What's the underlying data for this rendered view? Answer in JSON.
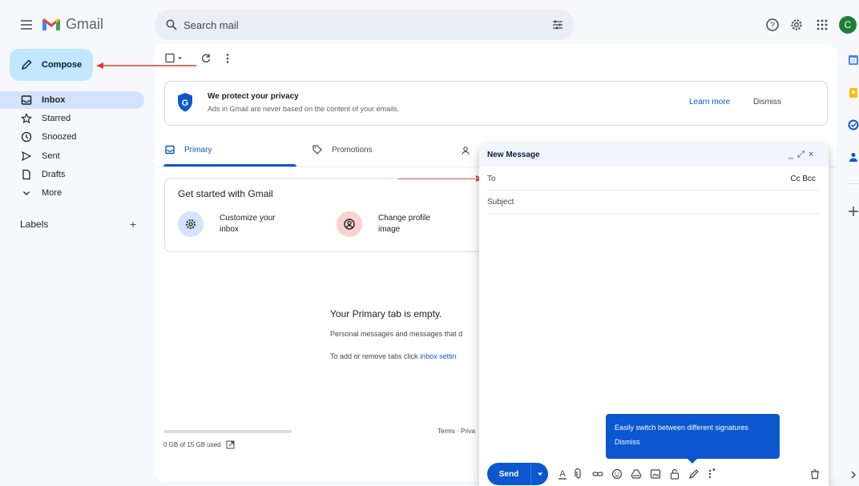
{
  "app": {
    "name": "Gmail",
    "avatar_letter": "C",
    "avatar_color": "#1e7e34",
    "accent": "#0b57d0"
  },
  "search": {
    "placeholder": "Search mail"
  },
  "sidebar": {
    "compose_label": "Compose",
    "items": [
      {
        "label": "Inbox",
        "icon": "inbox-icon"
      },
      {
        "label": "Starred",
        "icon": "star-icon"
      },
      {
        "label": "Snoozed",
        "icon": "clock-icon"
      },
      {
        "label": "Sent",
        "icon": "send-icon"
      },
      {
        "label": "Drafts",
        "icon": "draft-icon"
      },
      {
        "label": "More",
        "icon": "chevron-down-icon"
      }
    ],
    "labels_heading": "Labels",
    "labels_add": "+"
  },
  "privacy_banner": {
    "title": "We protect your privacy",
    "subtitle": "Ads in Gmail are never based on the content of your emails.",
    "learn_more": "Learn more",
    "dismiss": "Dismiss"
  },
  "tabs": [
    {
      "label": "Primary",
      "active": true
    },
    {
      "label": "Promotions",
      "active": false
    }
  ],
  "get_started": {
    "title": "Get started with Gmail",
    "cards": [
      {
        "label": "Customize your inbox"
      },
      {
        "label": "Change profile image"
      }
    ]
  },
  "empty_state": {
    "title": "Your Primary tab is empty.",
    "line1": "Personal messages and messages that d",
    "line2_prefix": "To add or remove tabs click ",
    "line2_link": "inbox settin"
  },
  "footer": {
    "storage": "0 GB of 15 GB used",
    "terms": "Terms · Priva"
  },
  "compose_window": {
    "title": "New Message",
    "controls": [
      "_",
      "⤢",
      "×"
    ],
    "to_label": "To",
    "cc_bcc": "Cc Bcc",
    "subject_placeholder": "Subject",
    "send_label": "Send"
  },
  "tooltip": {
    "text": "Easily switch between different signatures",
    "dismiss": "Dismiss"
  }
}
